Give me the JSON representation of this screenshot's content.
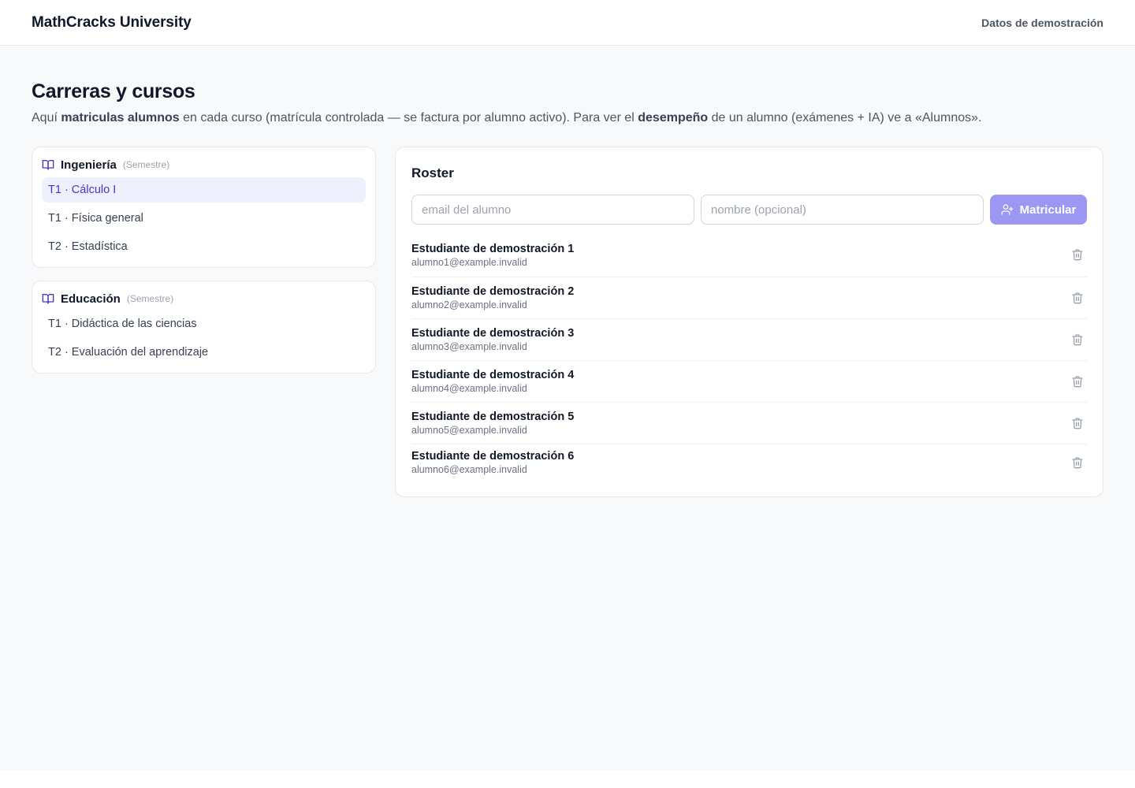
{
  "header": {
    "brand": "MathCracks University",
    "demo_link": "Datos de demostración"
  },
  "page": {
    "title": "Carreras y cursos",
    "subtitle_parts": {
      "p1": "Aquí ",
      "b1": "matriculas alumnos",
      "p2": " en cada curso (matrícula controlada — se factura por alumno activo). Para ver el ",
      "b2": "desempeño",
      "p3": " de un alumno (exámenes + IA) ve a «Alumnos»."
    }
  },
  "careers": [
    {
      "icon": "book-icon",
      "name": "Ingeniería",
      "period": "(Semestre)",
      "courses": [
        {
          "label": "T1 · Cálculo I",
          "active": true
        },
        {
          "label": "T1 · Física general",
          "active": false
        },
        {
          "label": "T2 · Estadística",
          "active": false
        }
      ]
    },
    {
      "icon": "book-icon",
      "name": "Educación",
      "period": "(Semestre)",
      "courses": [
        {
          "label": "T1 · Didáctica de las ciencias",
          "active": false
        },
        {
          "label": "T2 · Evaluación del aprendizaje",
          "active": false
        }
      ]
    }
  ],
  "roster": {
    "title": "Roster",
    "email_placeholder": "email del alumno",
    "name_placeholder": "nombre (opcional)",
    "enroll_label": "Matricular",
    "enroll_icon": "user-plus-icon",
    "delete_icon": "trash-icon",
    "students": [
      {
        "name": "Estudiante de demostración 1",
        "email": "alumno1@example.invalid"
      },
      {
        "name": "Estudiante de demostración 2",
        "email": "alumno2@example.invalid"
      },
      {
        "name": "Estudiante de demostración 3",
        "email": "alumno3@example.invalid"
      },
      {
        "name": "Estudiante de demostración 4",
        "email": "alumno4@example.invalid"
      },
      {
        "name": "Estudiante de demostración 5",
        "email": "alumno5@example.invalid"
      },
      {
        "name": "Estudiante de demostración 6",
        "email": "alumno6@example.invalid"
      }
    ]
  },
  "colors": {
    "accent": "#4338ca",
    "accent_bg": "#eef0fe",
    "button": "#9b97f2",
    "page_bg": "#f8f9fb"
  }
}
